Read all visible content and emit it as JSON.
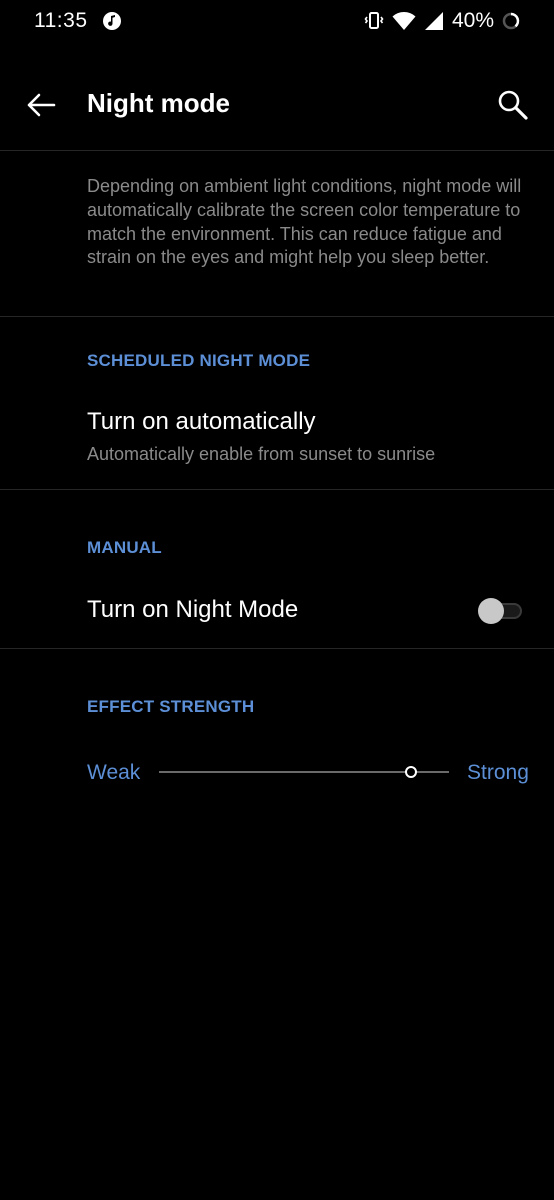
{
  "status_bar": {
    "time": "11:35",
    "battery_percent": "40%",
    "icons": [
      "music-note-icon",
      "vibrate-icon",
      "wifi-icon",
      "cellular-icon",
      "battery-ring-icon"
    ]
  },
  "app_bar": {
    "title": "Night mode",
    "back_icon": "arrow-left-icon",
    "search_icon": "search-icon"
  },
  "description": "Depending on ambient light conditions, night mode will automatically calibrate the screen color temperature to match the environment. This can reduce fatigue and strain on the eyes and might help you sleep better.",
  "sections": {
    "scheduled": {
      "header": "SCHEDULED NIGHT MODE",
      "title": "Turn on automatically",
      "summary": "Automatically enable from sunset to sunrise"
    },
    "manual": {
      "header": "MANUAL",
      "title": "Turn on Night Mode",
      "toggle_on": false
    },
    "effect": {
      "header": "EFFECT STRENGTH",
      "min_label": "Weak",
      "max_label": "Strong",
      "value_fraction": 0.87
    }
  },
  "colors": {
    "background": "#000000",
    "accent": "#5c8fd6",
    "secondary_text": "#8a8a8a",
    "divider": "#262626"
  }
}
